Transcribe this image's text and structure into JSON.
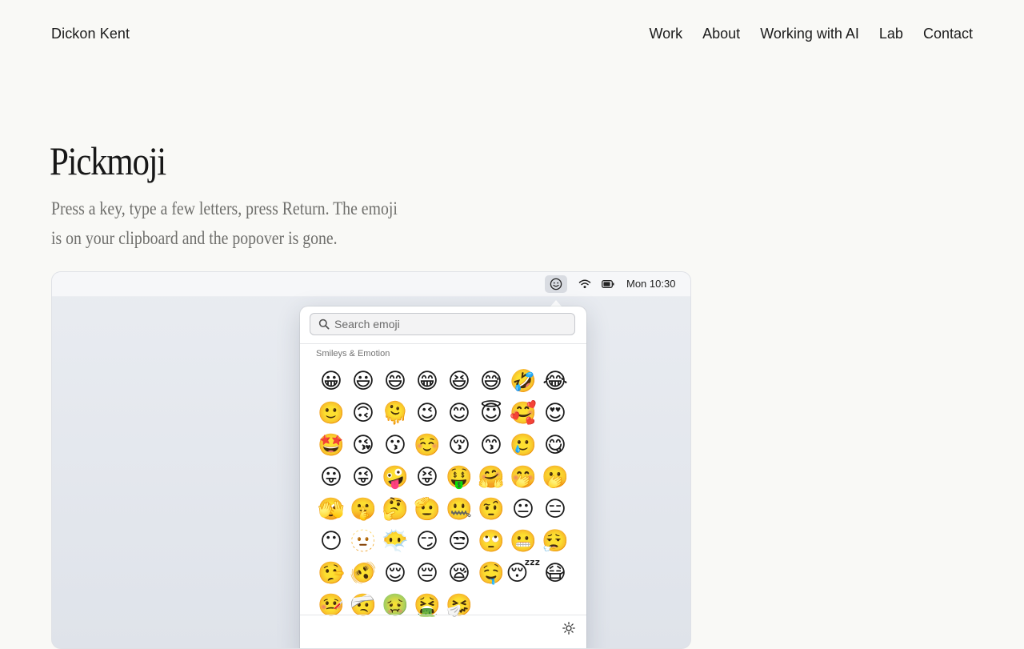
{
  "header": {
    "brand": "Dickon Kent",
    "nav": [
      {
        "label": "Work"
      },
      {
        "label": "About"
      },
      {
        "label": "Working with AI"
      },
      {
        "label": "Lab"
      },
      {
        "label": "Contact"
      }
    ]
  },
  "hero": {
    "title": "Pickmoji",
    "subtitle_line1": "Press a key, type a few letters, press Return. The emoji",
    "subtitle_line2": "is on your clipboard and the popover is gone."
  },
  "menubar": {
    "icons": [
      "smiley-icon",
      "wifi-icon",
      "battery-icon"
    ],
    "clock": "Mon 10:30"
  },
  "popover": {
    "search_placeholder": "Search emoji",
    "section": "Smileys & Emotion",
    "emojis": [
      "😀",
      "😃",
      "😄",
      "😁",
      "😆",
      "😅",
      "🤣",
      "😂",
      "🙂",
      "🙃",
      "🫠",
      "😉",
      "😊",
      "😇",
      "🥰",
      "😍",
      "🤩",
      "😘",
      "😗",
      "☺️",
      "😚",
      "😙",
      "🥲",
      "😋",
      "😛",
      "😜",
      "🤪",
      "😝",
      "🤑",
      "🤗",
      "🤭",
      "🫢",
      "🫣",
      "🤫",
      "🤔",
      "🫡",
      "🤐",
      "🤨",
      "😐",
      "😑",
      "😶",
      "🫥",
      "😶‍🌫️",
      "😏",
      "😒",
      "🙄",
      "😬",
      "😮‍💨",
      "🤥",
      "🫨",
      "😌",
      "😔",
      "😪",
      "🤤",
      "😴",
      "😷",
      "🤒",
      "🤕",
      "🤢",
      "🤮",
      "🤧",
      ""
    ],
    "footer_icon": "brightness-icon"
  },
  "colors": {
    "page_bg": "#f9f9f6",
    "text": "#1b1b1b",
    "subtitle": "#6f6f6c",
    "frame_bg": "#e3e7ee"
  }
}
